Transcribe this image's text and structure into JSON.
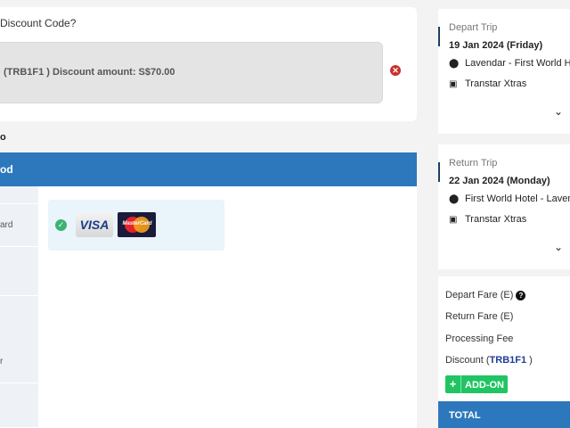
{
  "discount": {
    "question": "Discount Code?",
    "applied_text": "(TRB1F1 ) Discount amount: S$70.00",
    "remove_icon": "remove-icon"
  },
  "payment": {
    "heading": "o",
    "method_bar": "od",
    "tabs": [
      "",
      "ard",
      "",
      "r",
      ""
    ],
    "selected_card_icons": [
      "check-icon",
      "visa-logo",
      "mastercard-logo"
    ],
    "visa_text": "VISA",
    "mastercard_text": "MasterCard"
  },
  "depart_trip": {
    "label": "Depart Trip",
    "date": "19 Jan 2024 (Friday)",
    "route": "Lavendar - First World H",
    "operator": "Transtar Xtras"
  },
  "return_trip": {
    "label": "Return Trip",
    "date": "22 Jan 2024 (Monday)",
    "route": "First World Hotel - Laven",
    "operator": "Transtar Xtras"
  },
  "fare": {
    "depart_fare": "Depart Fare (E)",
    "return_fare": "Return Fare (E)",
    "processing_fee": "Processing Fee",
    "discount_prefix": "Discount (",
    "discount_code": "TRB1F1",
    "discount_suffix": " )",
    "addon_plus": "+",
    "addon_label": "ADD-ON",
    "total": "TOTAL"
  },
  "colors": {
    "accent_blue": "#2d78bd",
    "addon_green": "#20c463",
    "remove_red": "#c9302c"
  }
}
